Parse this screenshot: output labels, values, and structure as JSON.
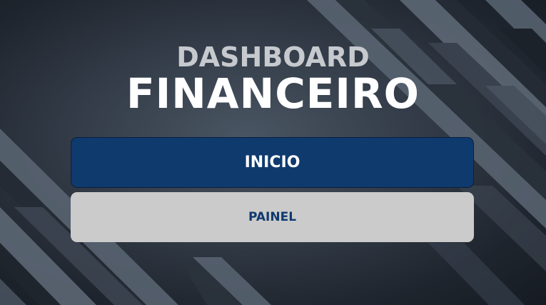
{
  "header": {
    "title_line1": "DASHBOARD",
    "title_line2": "FINANCEIRO"
  },
  "buttons": {
    "primary_label": "INICIO",
    "secondary_label": "PAINEL"
  },
  "colors": {
    "primary_button_bg": "#0f3a6e",
    "secondary_button_bg": "#cbcbcb",
    "secondary_button_text": "#0f3a6e",
    "title_light": "#c6c9ce",
    "title_white": "#ffffff"
  }
}
